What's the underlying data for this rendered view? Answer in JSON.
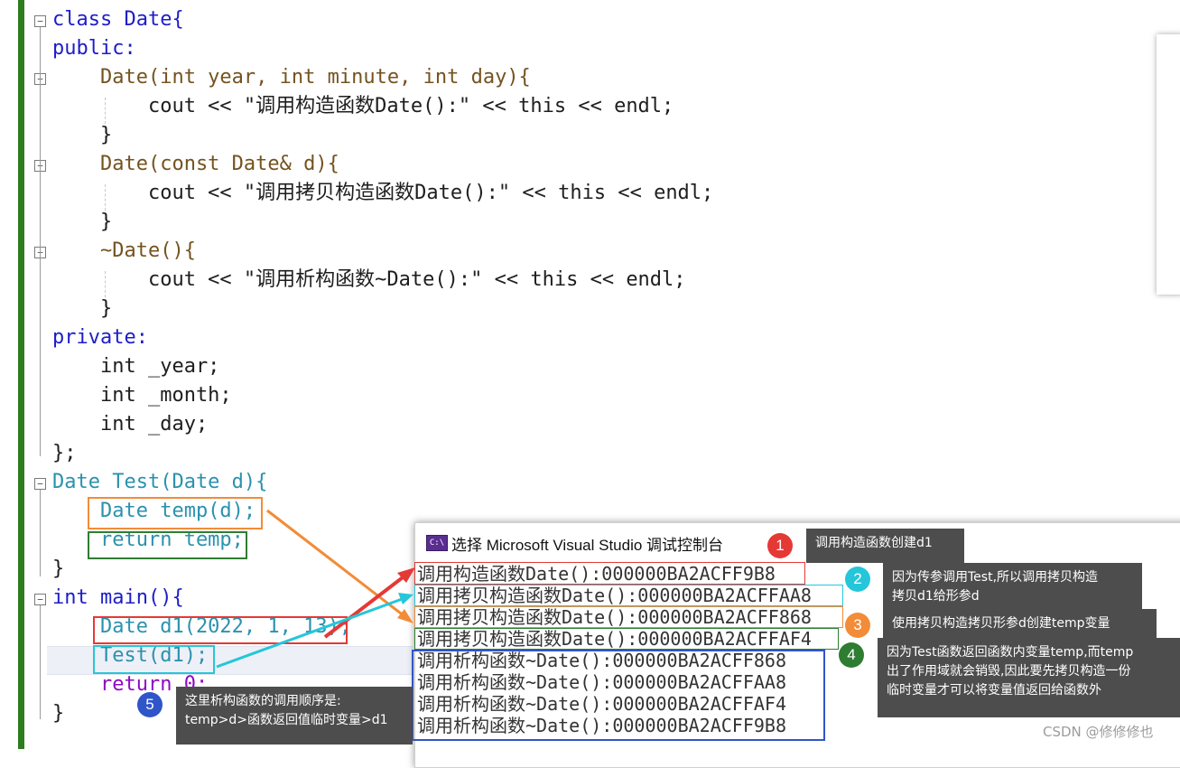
{
  "code": {
    "lines": [
      "class Date{",
      "public:",
      "    Date(int year, int minute, int day){",
      "        cout << \"调用构造函数Date():\" << this << endl;",
      "    }",
      "    Date(const Date& d){",
      "        cout << \"调用拷贝构造函数Date():\" << this << endl;",
      "    }",
      "    ~Date(){",
      "        cout << \"调用析构函数~Date():\" << this << endl;",
      "    }",
      "private:",
      "    int _year;",
      "    int _month;",
      "    int _day;",
      "};",
      "Date Test(Date d){",
      "    Date temp(d);",
      "    return temp;",
      "}",
      "int main(){",
      "    Date d1(2022, 1, 13);",
      "    Test(d1);",
      "    return 0;",
      "}"
    ]
  },
  "console": {
    "icon_text": "C:\\",
    "title": "选择 Microsoft Visual Studio 调试控制台",
    "lines": [
      "调用构造函数Date():000000BA2ACFF9B8",
      "调用拷贝构造函数Date():000000BA2ACFFAA8",
      "调用拷贝构造函数Date():000000BA2ACFF868",
      "调用拷贝构造函数Date():000000BA2ACFFAF4",
      "调用析构函数~Date():000000BA2ACFF868",
      "调用析构函数~Date():000000BA2ACFFAA8",
      "调用析构函数~Date():000000BA2ACFFAF4",
      "调用析构函数~Date():000000BA2ACFF9B8"
    ]
  },
  "annotations": [
    {
      "number": "1",
      "color": "#e53935",
      "text": "调用构造函数创建d1"
    },
    {
      "number": "2",
      "color": "#26c6da",
      "text": "因为传参调用Test,所以调用拷贝构造\n拷贝d1给形参d"
    },
    {
      "number": "3",
      "color": "#f28c38",
      "text": "使用拷贝构造拷贝形参d创建temp变量"
    },
    {
      "number": "4",
      "color": "#2e7d32",
      "text": "因为Test函数返回函数内变量temp,而temp\n出了作用域就会销毁,因此要先拷贝构造一份\n临时变量才可以将变量值返回给函数外"
    },
    {
      "number": "5",
      "color": "#2f55c9",
      "text": "这里析构函数的调用顺序是:\ntemp>d>函数返回值临时变量>d1"
    }
  ],
  "colors": {
    "red": "#e53935",
    "cyan": "#26c6da",
    "orange": "#f28c38",
    "green": "#2e7d32",
    "blue": "#2f55c9"
  },
  "watermark": "CSDN @修修修也"
}
